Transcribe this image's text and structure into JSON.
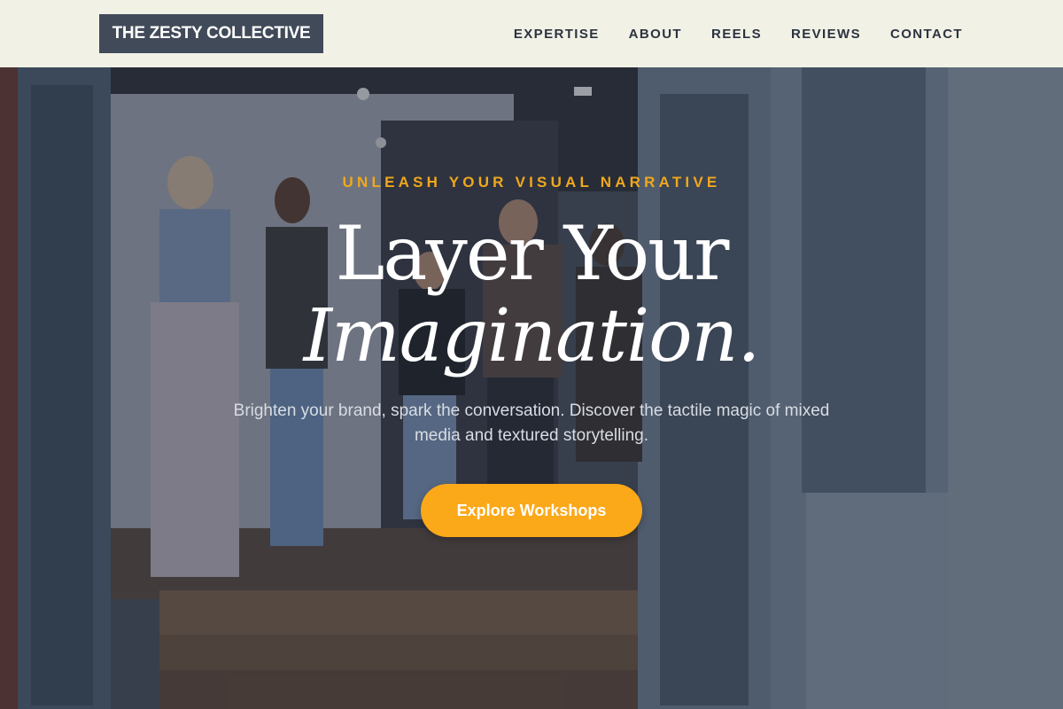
{
  "header": {
    "logo": "THE ZESTY COLLECTIVE",
    "nav": [
      "EXPERTISE",
      "ABOUT",
      "REELS",
      "REVIEWS",
      "CONTACT"
    ]
  },
  "hero": {
    "eyebrow": "UNLEASH YOUR VISUAL NARRATIVE",
    "title_line1": "Layer Your",
    "title_line2": "Imagination.",
    "subtitle": "Brighten your brand, spark the conversation. Discover the tactile magic of mixed media and textured storytelling.",
    "cta_label": "Explore Workshops"
  },
  "colors": {
    "header_bg": "#f1f1e6",
    "logo_bg": "#414a58",
    "accent": "#fba819",
    "eyebrow": "#f0a81c"
  }
}
